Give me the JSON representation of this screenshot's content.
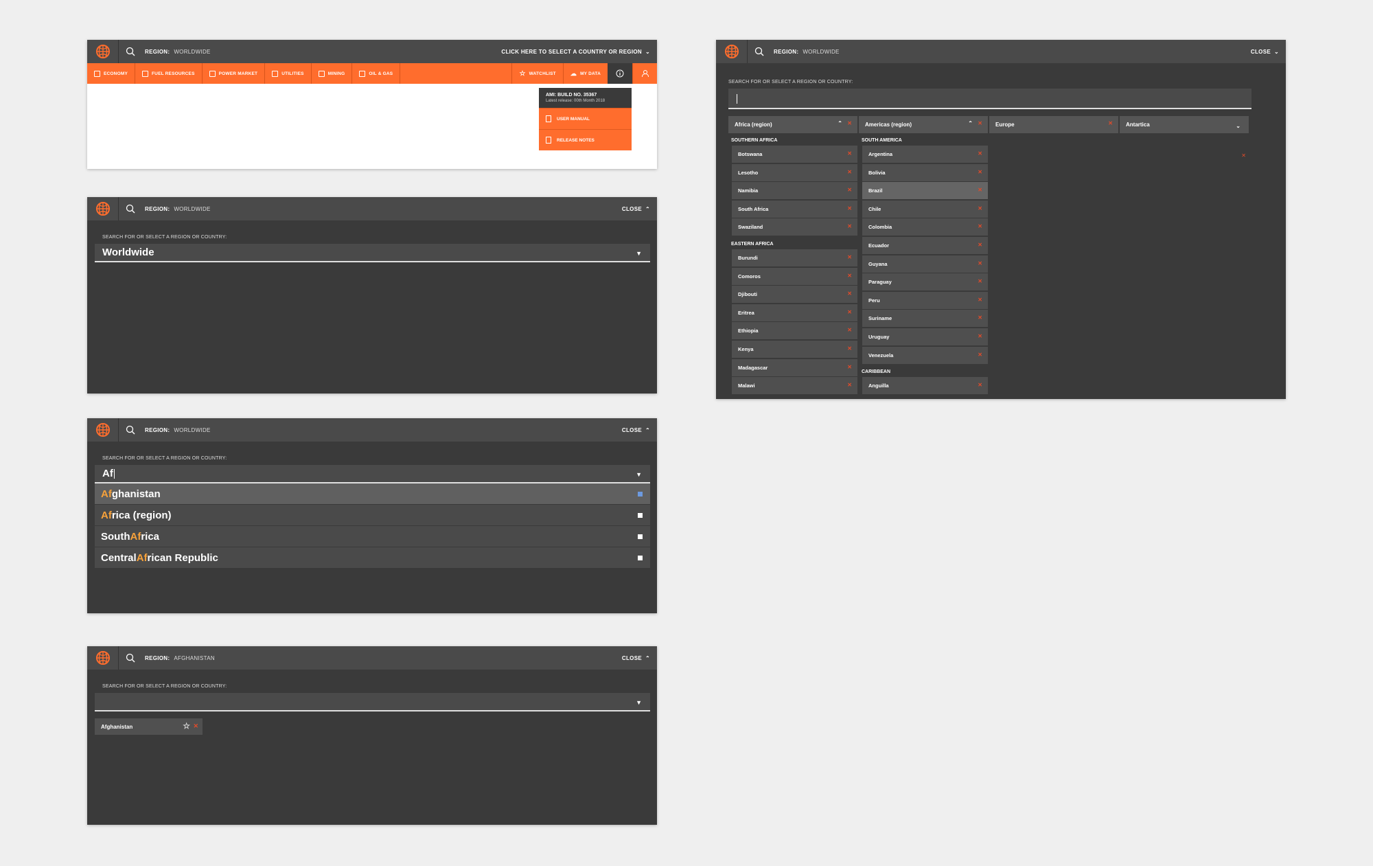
{
  "header": {
    "region_label": "REGION:",
    "region_value_worldwide": "WORLDWIDE",
    "region_value_afghanistan": "AFGHANISTAN",
    "select_country_prompt": "CLICK HERE TO SELECT A COUNTRY OR REGION",
    "close_label": "CLOSE"
  },
  "nav": {
    "left": [
      "ECONOMY",
      "FUEL RESOURCES",
      "POWER MARKET",
      "UTILITIES",
      "MINING",
      "OIL & GAS"
    ],
    "watchlist": "WATCHLIST",
    "my_data": "MY DATA"
  },
  "info_dropdown": {
    "build": "AMI: BUILD NO. 35367",
    "release": "Latest release: 00th Month 2018",
    "user_manual": "USER MANUAL",
    "release_notes": "RELEASE NOTES"
  },
  "search": {
    "label": "SEARCH FOR OR SELECT A REGION OR COUNTRY:",
    "worldwide_value": "Worldwide",
    "typed_value": "Af"
  },
  "results": [
    {
      "hi": "Af",
      "pre": "",
      "post": "ghanistan"
    },
    {
      "hi": "Af",
      "pre": "",
      "post": "rica (region)"
    },
    {
      "hi": "Af",
      "pre": "South ",
      "post": "rica"
    },
    {
      "hi": "Af",
      "pre": "Central ",
      "post": "rican Republic"
    }
  ],
  "selected_chip": "Afghanistan",
  "region_columns": [
    {
      "name": "Africa (region)",
      "groups": [
        {
          "title": "SOUTHERN AFRICA",
          "items": [
            "Botswana",
            "Lesotho",
            "Namibia",
            "South Africa",
            "Swaziland"
          ]
        },
        {
          "title": "EASTERN AFRICA",
          "items": [
            "Burundi",
            "Comoros",
            "Djibouti",
            "Eritrea",
            "Ethiopia",
            "Kenya",
            "Madagascar",
            "Malawi"
          ]
        }
      ]
    },
    {
      "name": "Americas (region)",
      "groups": [
        {
          "title": "SOUTH AMERICA",
          "items": [
            "Argentina",
            "Bolivia",
            "Brazil",
            "Chile",
            "Colombia",
            "Ecuador",
            "Guyana",
            "Paraguay",
            "Peru",
            "Suriname",
            "Uruguay",
            "Venezuela"
          ]
        },
        {
          "title": "CARIBBEAN",
          "items": [
            "Anguilla"
          ]
        }
      ]
    },
    {
      "name": "Europe",
      "groups": []
    },
    {
      "name": "Antartica",
      "groups": []
    }
  ],
  "colors": {
    "accent": "#ff6d2d",
    "panel": "#3a3a3a",
    "remove": "#e34b2a",
    "highlight": "#f7a23b"
  }
}
